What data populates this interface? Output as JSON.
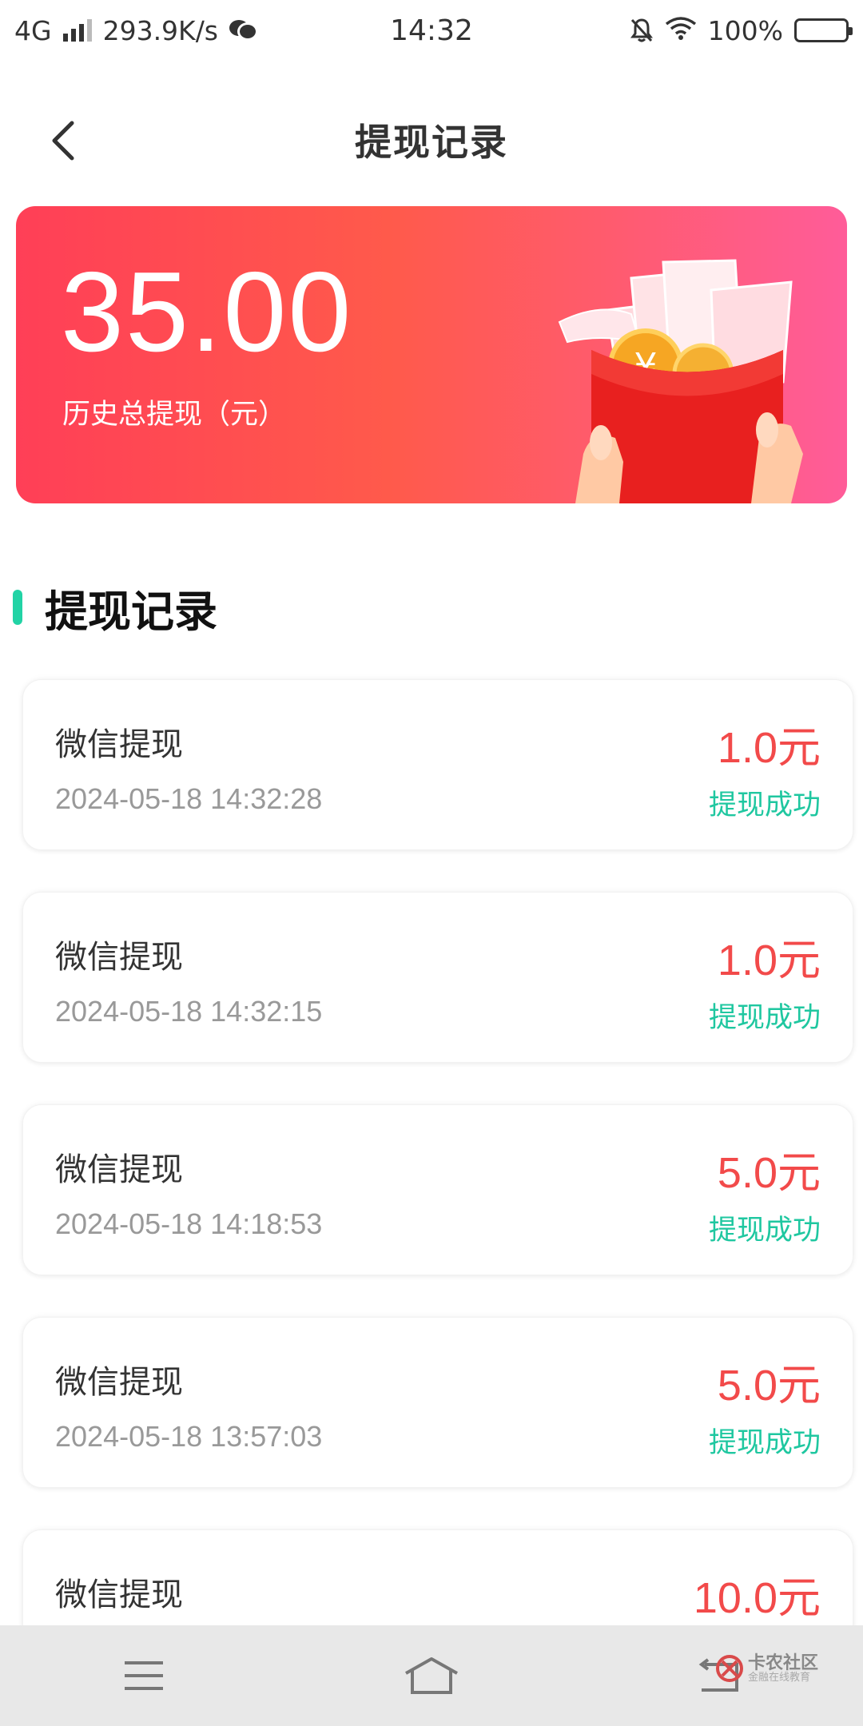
{
  "status_bar": {
    "network": "4G",
    "speed": "293.9K/s",
    "time": "14:32",
    "battery": "100%"
  },
  "header": {
    "title": "提现记录"
  },
  "summary": {
    "total_amount": "35.00",
    "total_label": "历史总提现（元）"
  },
  "section": {
    "title": "提现记录"
  },
  "records": [
    {
      "method": "微信提现",
      "time": "2024-05-18 14:32:28",
      "amount": "1.0元",
      "status": "提现成功"
    },
    {
      "method": "微信提现",
      "time": "2024-05-18 14:32:15",
      "amount": "1.0元",
      "status": "提现成功"
    },
    {
      "method": "微信提现",
      "time": "2024-05-18 14:18:53",
      "amount": "5.0元",
      "status": "提现成功"
    },
    {
      "method": "微信提现",
      "time": "2024-05-18 13:57:03",
      "amount": "5.0元",
      "status": "提现成功"
    },
    {
      "method": "微信提现",
      "time": "",
      "amount": "10.0元",
      "status": ""
    }
  ],
  "nav": {
    "items": [
      "menu-icon",
      "home-icon",
      "back-icon"
    ]
  },
  "watermark": {
    "main": "卡农社区",
    "sub": "金融在线教育"
  },
  "colors": {
    "accent_green": "#1fc7a0",
    "amount_red": "#f24a4a",
    "banner_start": "#ff3f57",
    "banner_end": "#ff5c99"
  }
}
